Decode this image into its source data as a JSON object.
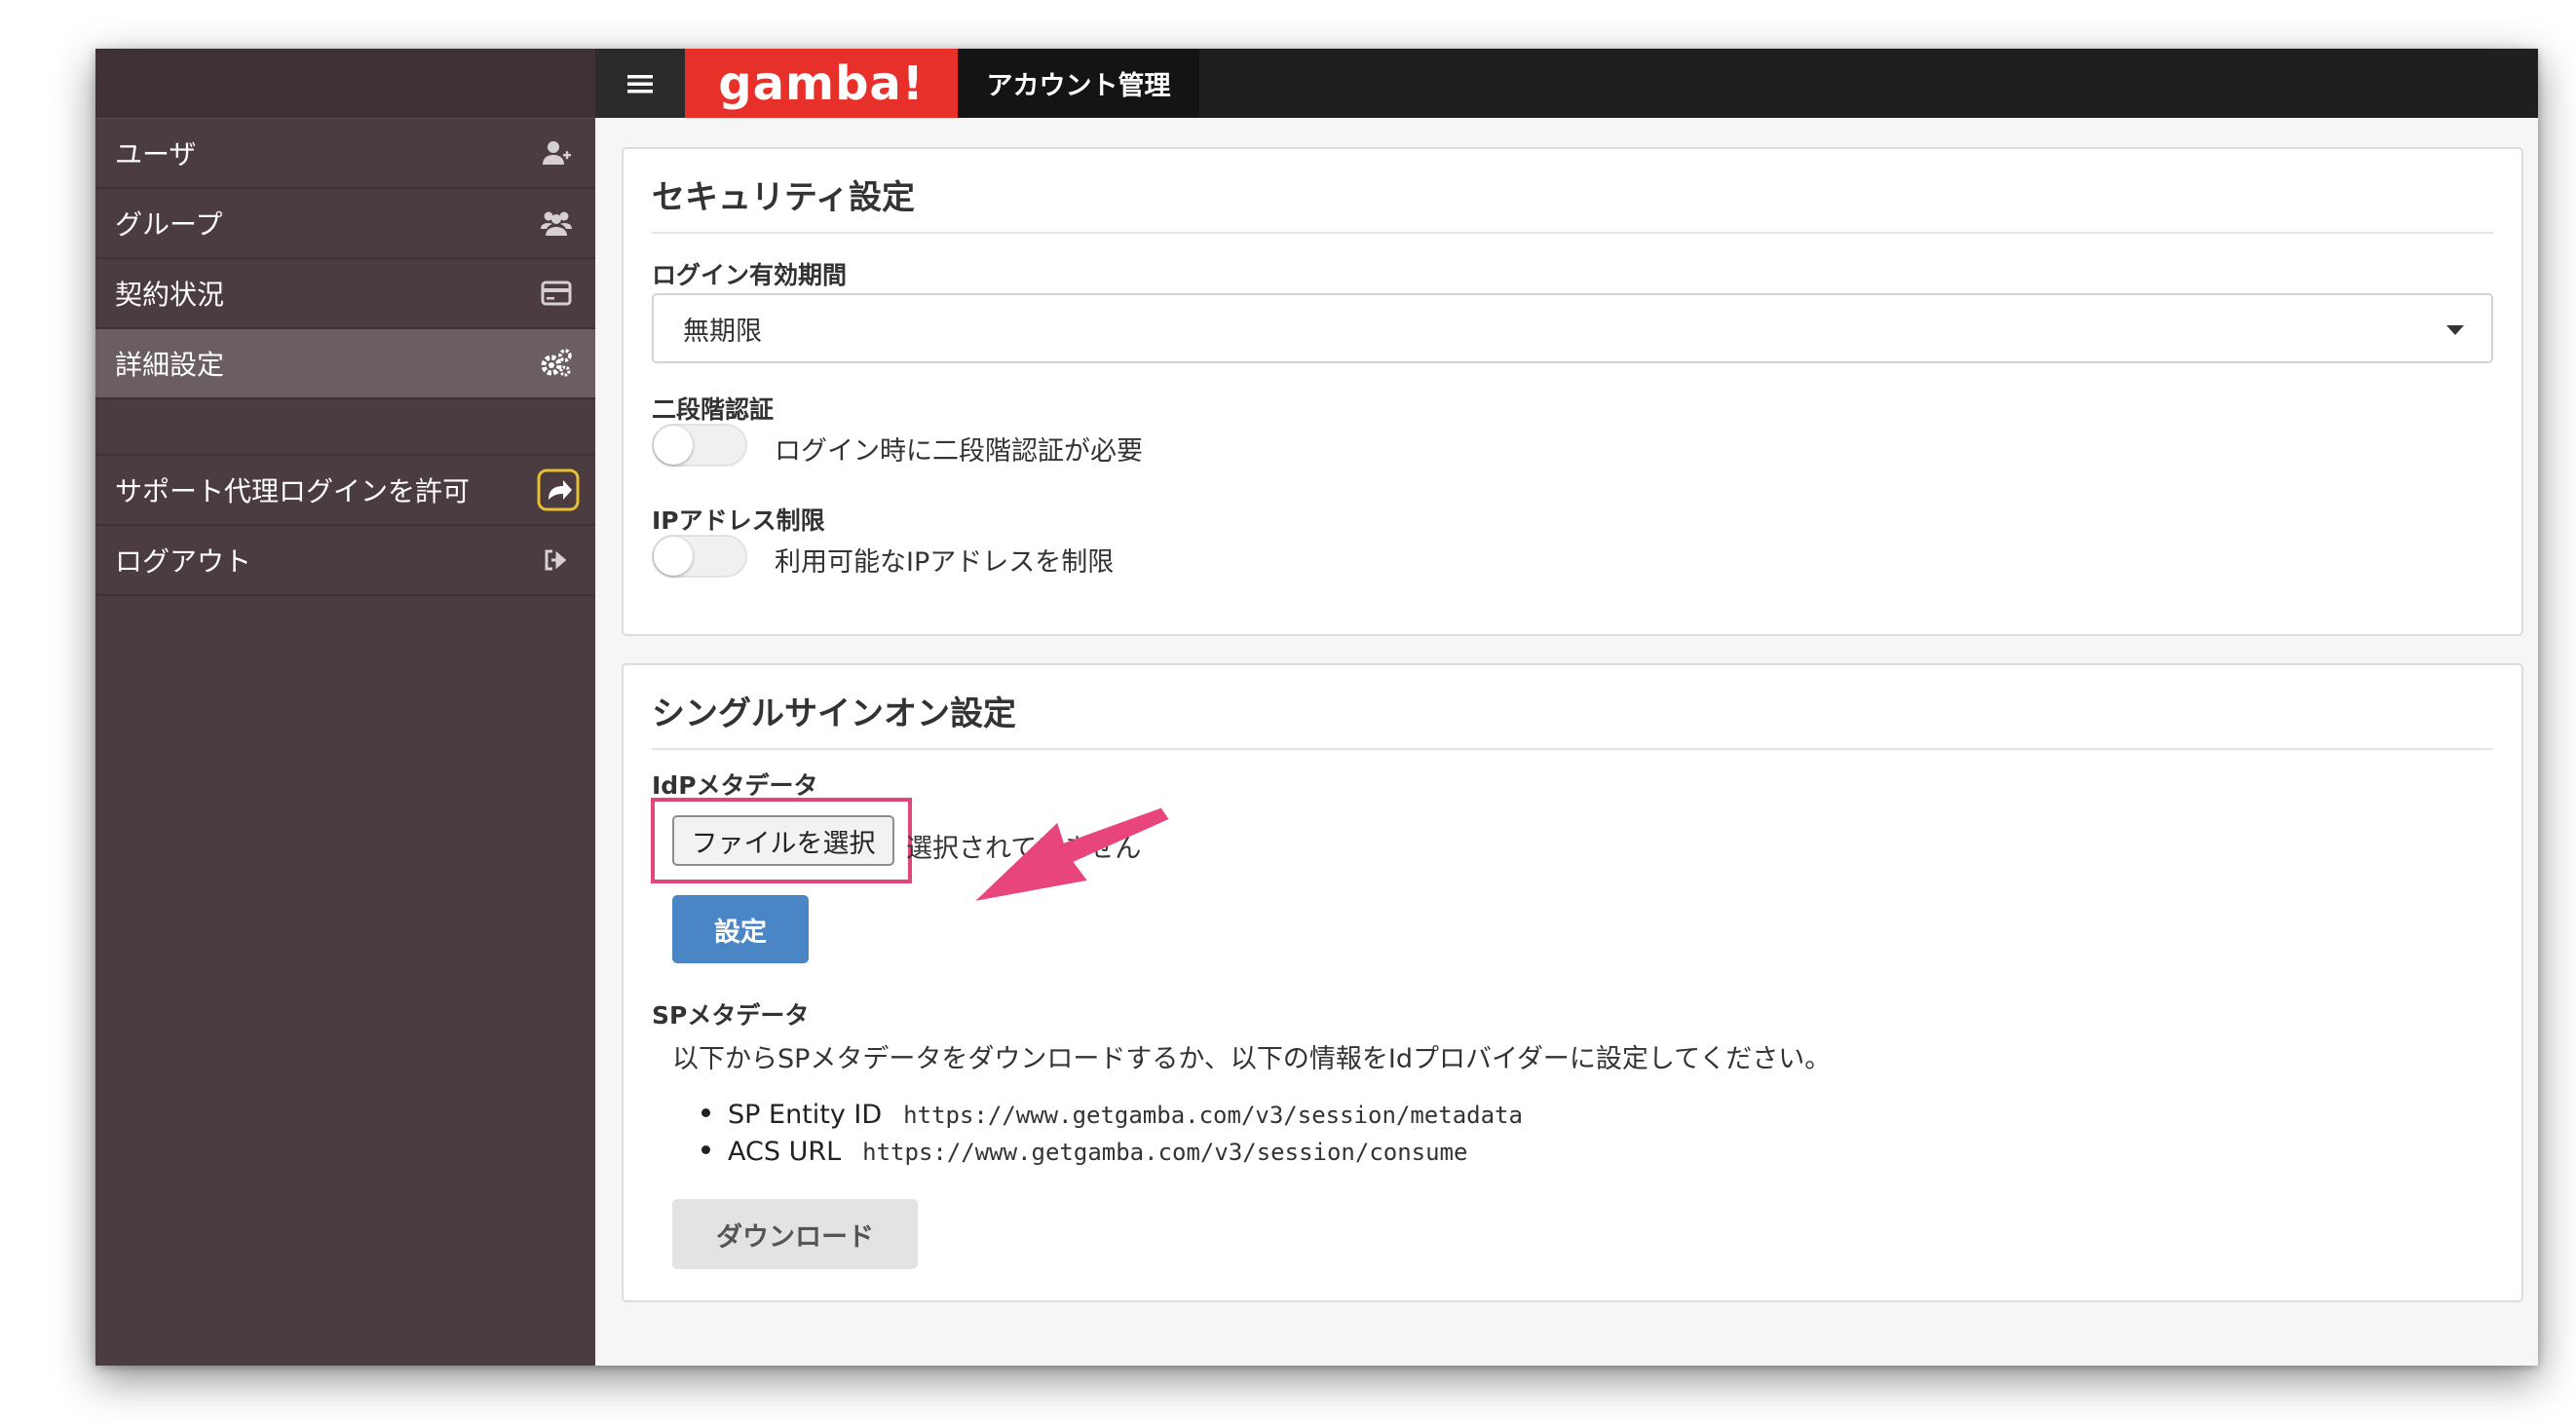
{
  "header": {
    "logo_text": "gamba!",
    "app_title": "アカウント管理",
    "menu_icon": "hamburger-menu-icon"
  },
  "sidebar": {
    "items": [
      {
        "label": "ユーザ",
        "icon": "add-user-icon",
        "active": false
      },
      {
        "label": "グループ",
        "icon": "group-icon",
        "active": false
      },
      {
        "label": "契約状況",
        "icon": "credit-card-icon",
        "active": false
      },
      {
        "label": "詳細設定",
        "icon": "gears-icon",
        "active": true
      }
    ],
    "bottom_items": [
      {
        "label": "サポート代理ログインを許可",
        "icon": "share-arrow-icon"
      },
      {
        "label": "ログアウト",
        "icon": "sign-out-icon"
      }
    ]
  },
  "security": {
    "title": "セキュリティ設定",
    "login_period_label": "ログイン有効期間",
    "login_period_value": "無期限",
    "two_factor_label": "二段階認証",
    "two_factor_toggle_text": "ログイン時に二段階認証が必要",
    "two_factor_enabled": false,
    "ip_label": "IPアドレス制限",
    "ip_toggle_text": "利用可能なIPアドレスを制限",
    "ip_enabled": false
  },
  "sso": {
    "title": "シングルサインオン設定",
    "idp_label": "IdPメタデータ",
    "file_button": "ファイルを選択",
    "file_status": "選択されていません",
    "set_button": "設定",
    "sp_label": "SPメタデータ",
    "sp_description": "以下からSPメタデータをダウンロードするか、以下の情報をIdプロバイダーに設定してください。",
    "sp_entries": [
      {
        "name": "SP Entity ID",
        "value": "https://www.getgamba.com/v3/session/metadata"
      },
      {
        "name": "ACS URL",
        "value": "https://www.getgamba.com/v3/session/consume"
      }
    ],
    "download_button": "ダウンロード"
  },
  "colors": {
    "brand_red": "#e8302a",
    "sidebar_bg": "#4a3c40",
    "primary_blue": "#4a86c5",
    "annotation_pink": "#e0457b"
  }
}
